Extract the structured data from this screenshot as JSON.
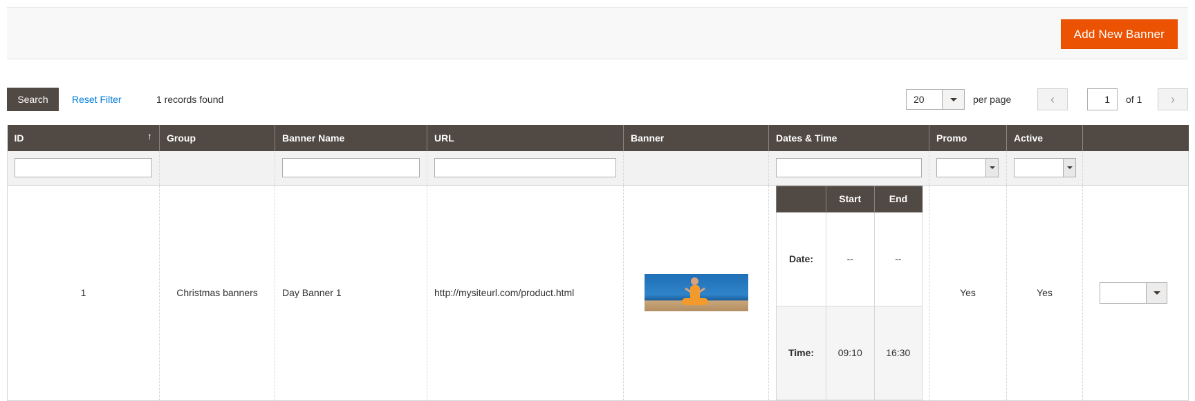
{
  "header": {
    "add_button_label": "Add New Banner"
  },
  "toolbar": {
    "search_label": "Search",
    "reset_label": "Reset Filter",
    "records_text": "1 records found",
    "per_page_value": "20",
    "per_page_label": "per page",
    "page_value": "1",
    "page_of": "of 1"
  },
  "grid": {
    "columns": [
      "ID",
      "Group",
      "Banner Name",
      "URL",
      "Banner",
      "Dates & Time",
      "Promo",
      "Active",
      ""
    ],
    "sort_indicator": "↑",
    "row": {
      "id": "1",
      "group": "Christmas banners",
      "name": "Day Banner 1",
      "url": "http://mysiteurl.com/product.html",
      "promo": "Yes",
      "active": "Yes"
    },
    "dates_table": {
      "head_start": "Start",
      "head_end": "End",
      "date_label": "Date:",
      "date_start": "--",
      "date_end": "--",
      "time_label": "Time:",
      "time_start": "09:10",
      "time_end": "16:30"
    }
  },
  "colors": {
    "accent": "#eb5202",
    "header_bg": "#514943",
    "link": "#007bdb"
  }
}
